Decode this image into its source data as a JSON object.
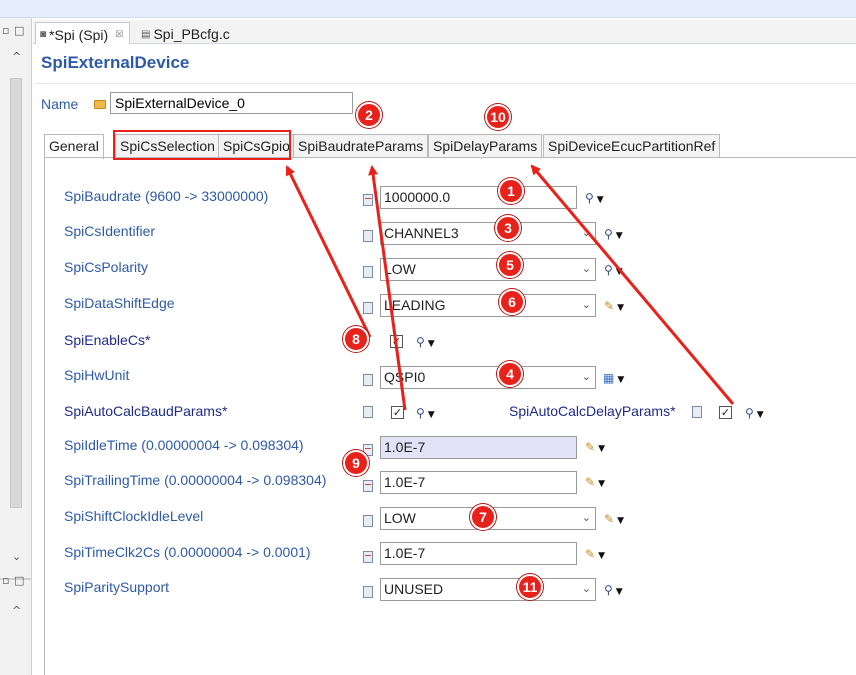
{
  "editor_tabs": [
    {
      "label": "*Spi (Spi)",
      "close": "☒"
    },
    {
      "label": "Spi_PBcfg.c"
    }
  ],
  "editor_title": "SpiExternalDevice",
  "name": {
    "label": "Name",
    "value": "SpiExternalDevice_0"
  },
  "param_tabs": [
    "General",
    "SpiCsSelection",
    "SpiCsGpio",
    "SpiBaudrateParams",
    "SpiDelayParams",
    "SpiDeviceEcucPartitionRef"
  ],
  "params": {
    "baudrate": {
      "label": "SpiBaudrate (9600 -> 33000000)",
      "value": "1000000.0"
    },
    "cs_identifier": {
      "label": "SpiCsIdentifier",
      "value": "CHANNEL3"
    },
    "cs_polarity": {
      "label": "SpiCsPolarity",
      "value": "LOW"
    },
    "data_shift_edge": {
      "label": "SpiDataShiftEdge",
      "value": "LEADING"
    },
    "enable_cs": {
      "label": "SpiEnableCs*",
      "checked": "✓"
    },
    "hw_unit": {
      "label": "SpiHwUnit",
      "value": "QSPI0"
    },
    "auto_calc_baud": {
      "label": "SpiAutoCalcBaudParams*",
      "checked": "✓"
    },
    "auto_calc_delay": {
      "label": "SpiAutoCalcDelayParams*",
      "checked": "✓"
    },
    "idle_time": {
      "label": "SpiIdleTime (0.00000004 -> 0.098304)",
      "value": "1.0E-7"
    },
    "trailing_time": {
      "label": "SpiTrailingTime (0.00000004 -> 0.098304)",
      "value": "1.0E-7"
    },
    "shift_clock_idle": {
      "label": "SpiShiftClockIdleLevel",
      "value": "LOW"
    },
    "time_clk2cs": {
      "label": "SpiTimeClk2Cs (0.00000004 -> 0.0001)",
      "value": "1.0E-7"
    },
    "parity_support": {
      "label": "SpiParitySupport",
      "value": "UNUSED"
    }
  },
  "annotations": [
    "1",
    "2",
    "3",
    "4",
    "5",
    "6",
    "7",
    "8",
    "9",
    "10",
    "11"
  ],
  "colors": {
    "annotation_red": "#e8211a",
    "label_blue": "#2d5aa8",
    "title_blue": "#2d5aa8"
  },
  "icons": {
    "dropdown": "⌄",
    "action_arrow": "▼",
    "scroll_up": "^",
    "scroll_down": "⌄"
  }
}
